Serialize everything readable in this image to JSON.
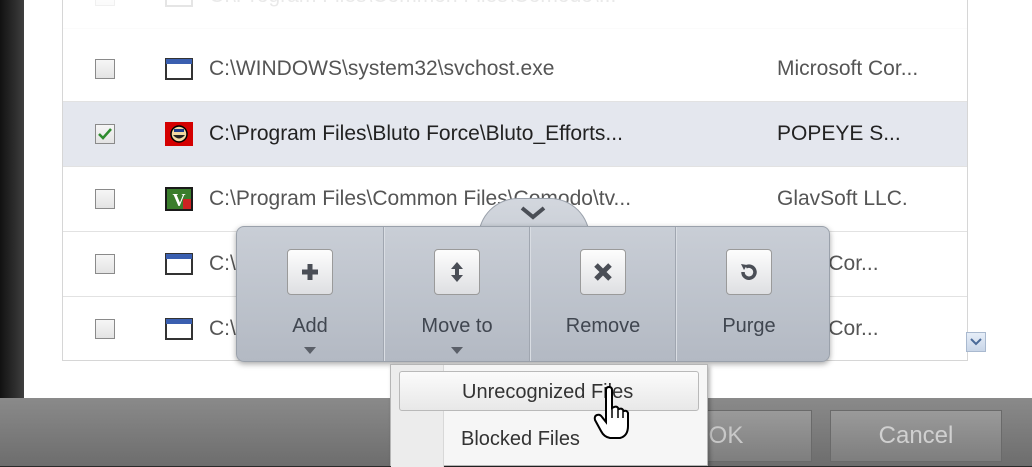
{
  "file_list": {
    "rows": [
      {
        "checked": false,
        "icon": "window-icon",
        "path": "C:\\Program Files\\Common Files\\Comodo\\...",
        "company": ""
      },
      {
        "checked": false,
        "icon": "window-icon",
        "path": "C:\\WINDOWS\\system32\\svchost.exe",
        "company": "Microsoft Cor..."
      },
      {
        "checked": true,
        "icon": "bluto-app-icon",
        "path": "C:\\Program Files\\Bluto Force\\Bluto_Efforts...",
        "company": "POPEYE S..."
      },
      {
        "checked": false,
        "icon": "tightvnc-icon",
        "path": "C:\\Program Files\\Common Files\\Comodo\\tv...",
        "company": "GlavSoft LLC."
      },
      {
        "checked": false,
        "icon": "window-icon",
        "path": "C:\\",
        "company": "osoft Cor..."
      },
      {
        "checked": false,
        "icon": "window-icon",
        "path": "C:\\",
        "company": "osoft Cor..."
      }
    ]
  },
  "toolbar": {
    "add_label": "Add",
    "move_label": "Move to",
    "remove_label": "Remove",
    "purge_label": "Purge"
  },
  "move_menu": {
    "items": [
      {
        "label": "Unrecognized Files",
        "hovered": true
      },
      {
        "label": "Blocked Files",
        "hovered": false
      }
    ]
  },
  "dialog_buttons": {
    "ok_label": "OK",
    "cancel_label": "Cancel"
  },
  "colors": {
    "selected_row": "#e4e7ee",
    "toolbar_bg": "#c0c5cd",
    "check_green": "#2e8b2e"
  }
}
